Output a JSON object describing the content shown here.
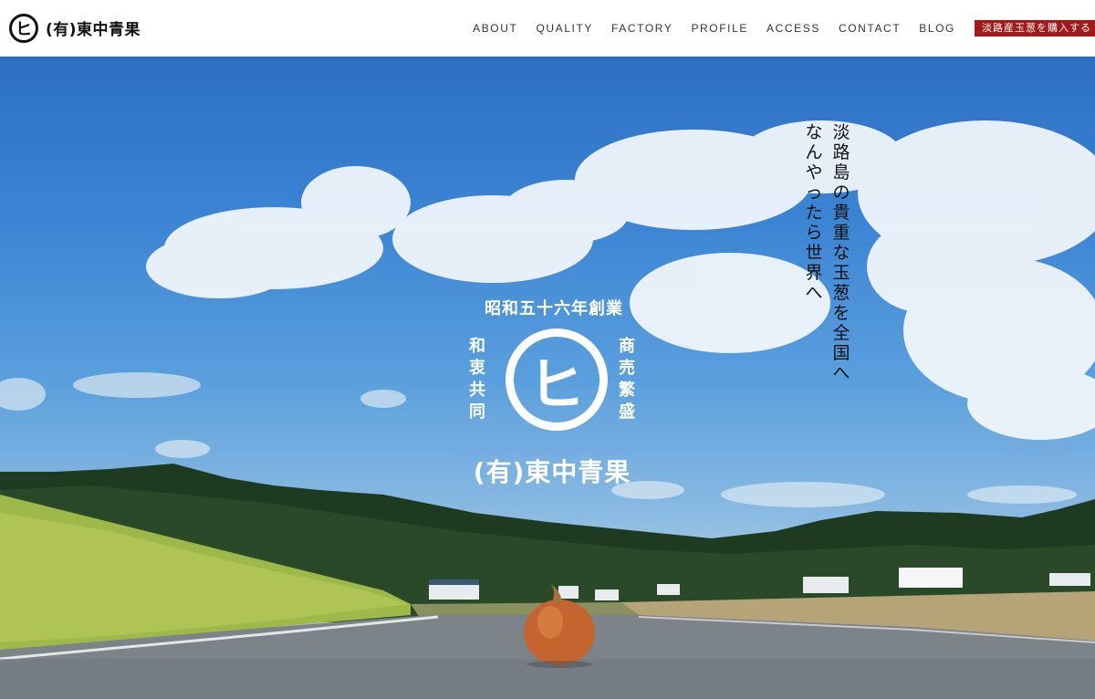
{
  "header": {
    "brand_mark": "ヒ",
    "brand_name": "(有)東中青果",
    "nav": [
      "ABOUT",
      "QUALITY",
      "FACTORY",
      "PROFILE",
      "ACCESS",
      "CONTACT",
      "BLOG"
    ],
    "buy_button": "淡路産玉葱を購入する"
  },
  "hero": {
    "emblem": {
      "top": "昭和五十六年創業",
      "left": "和衷共同",
      "right": "商売繁盛",
      "center": "ヒ",
      "bottom": "(有)東中青果"
    },
    "tagline_line1": "淡路島の貴重な玉葱を全国へ",
    "tagline_line2": "なんやったら世界へ"
  },
  "colors": {
    "accent": "#a3191a",
    "sky": "#3b84d4"
  }
}
